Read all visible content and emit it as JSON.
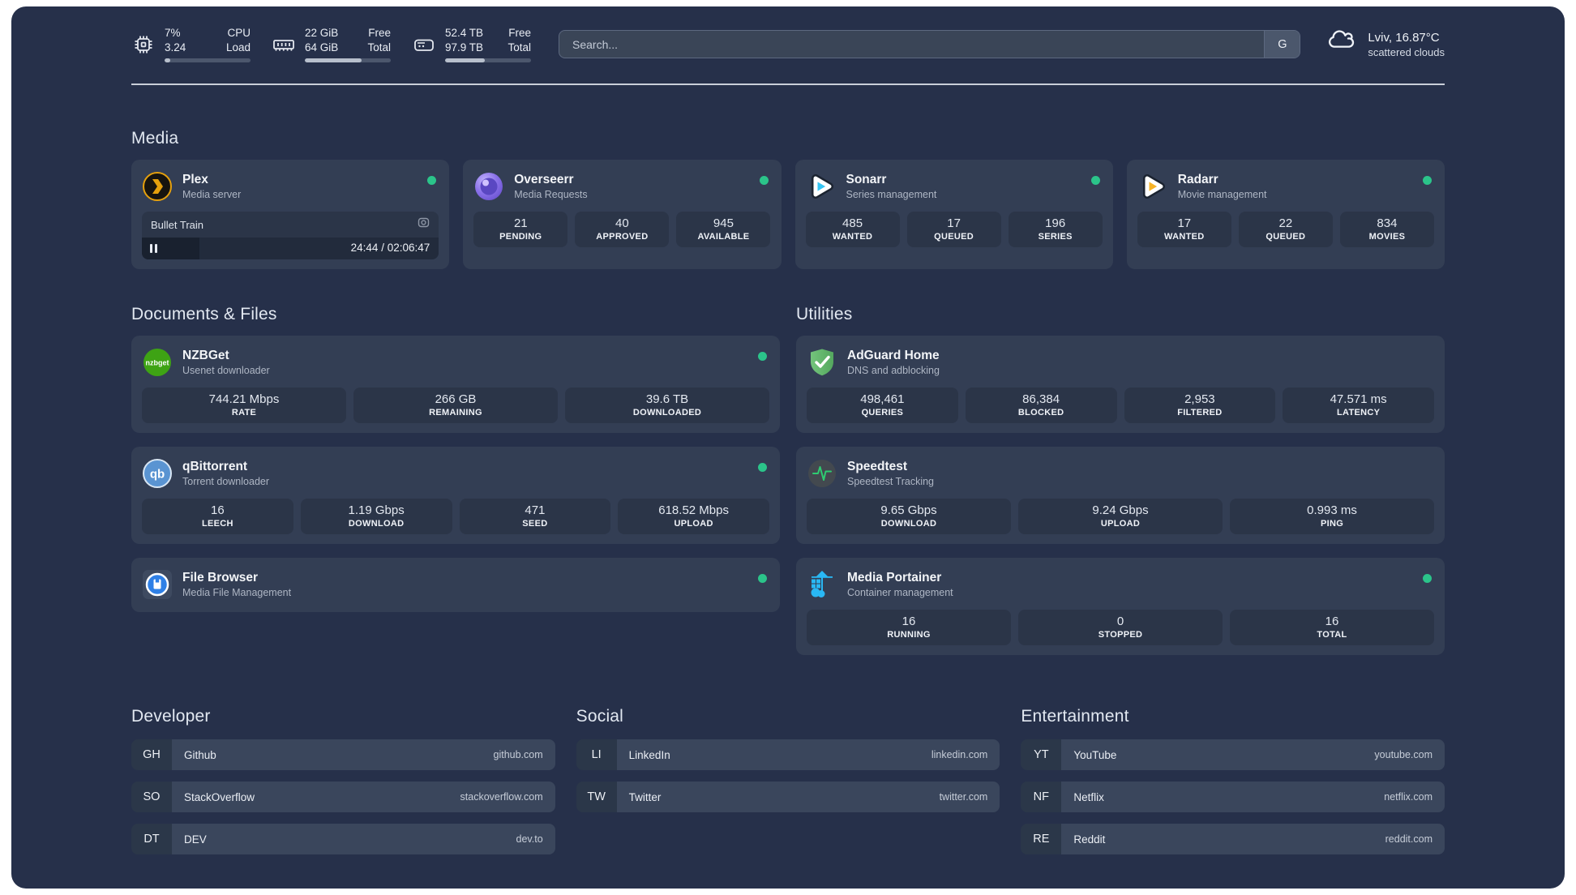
{
  "colors": {
    "status_online": "#2bc48a",
    "panel_bg": "#26304a",
    "card_bg": "#333e54",
    "stat_bg": "#2b3548"
  },
  "topbar": {
    "resources": [
      {
        "icon": "cpu-icon",
        "values": [
          "7%",
          "3.24"
        ],
        "labels": [
          "CPU",
          "Load"
        ],
        "percent": 7
      },
      {
        "icon": "memory-icon",
        "values": [
          "22 GiB",
          "64 GiB"
        ],
        "labels": [
          "Free",
          "Total"
        ],
        "percent": 66
      },
      {
        "icon": "disk-icon",
        "values": [
          "52.4 TB",
          "97.9 TB"
        ],
        "labels": [
          "Free",
          "Total"
        ],
        "percent": 46
      }
    ],
    "search": {
      "placeholder": "Search...",
      "provider_button": "G"
    },
    "weather": {
      "title": "Lviv, 16.87°C",
      "subtitle": "scattered clouds"
    }
  },
  "media": {
    "title": "Media",
    "cards": [
      {
        "title": "Plex",
        "subtitle": "Media server",
        "online": true,
        "player": {
          "track": "Bullet Train",
          "time": "24:44 / 02:06:47",
          "progress_percent": 19.5
        }
      },
      {
        "title": "Overseerr",
        "subtitle": "Media Requests",
        "online": true,
        "stats": [
          {
            "value": "21",
            "label": "PENDING"
          },
          {
            "value": "40",
            "label": "APPROVED"
          },
          {
            "value": "945",
            "label": "AVAILABLE"
          }
        ]
      },
      {
        "title": "Sonarr",
        "subtitle": "Series management",
        "online": true,
        "stats": [
          {
            "value": "485",
            "label": "WANTED"
          },
          {
            "value": "17",
            "label": "QUEUED"
          },
          {
            "value": "196",
            "label": "SERIES"
          }
        ]
      },
      {
        "title": "Radarr",
        "subtitle": "Movie management",
        "online": true,
        "stats": [
          {
            "value": "17",
            "label": "WANTED"
          },
          {
            "value": "22",
            "label": "QUEUED"
          },
          {
            "value": "834",
            "label": "MOVIES"
          }
        ]
      }
    ]
  },
  "docs": {
    "title": "Documents & Files",
    "cards": [
      {
        "title": "NZBGet",
        "subtitle": "Usenet downloader",
        "online": true,
        "stats": [
          {
            "value": "744.21 Mbps",
            "label": "RATE"
          },
          {
            "value": "266 GB",
            "label": "REMAINING"
          },
          {
            "value": "39.6 TB",
            "label": "DOWNLOADED"
          }
        ]
      },
      {
        "title": "qBittorrent",
        "subtitle": "Torrent downloader",
        "online": true,
        "stats": [
          {
            "value": "16",
            "label": "LEECH"
          },
          {
            "value": "1.19 Gbps",
            "label": "DOWNLOAD"
          },
          {
            "value": "471",
            "label": "SEED"
          },
          {
            "value": "618.52 Mbps",
            "label": "UPLOAD"
          }
        ]
      },
      {
        "title": "File Browser",
        "subtitle": "Media File Management",
        "online": true,
        "stats": []
      }
    ]
  },
  "utilities": {
    "title": "Utilities",
    "cards": [
      {
        "title": "AdGuard Home",
        "subtitle": "DNS and adblocking",
        "online": false,
        "stats": [
          {
            "value": "498,461",
            "label": "QUERIES"
          },
          {
            "value": "86,384",
            "label": "BLOCKED"
          },
          {
            "value": "2,953",
            "label": "FILTERED"
          },
          {
            "value": "47.571 ms",
            "label": "LATENCY"
          }
        ]
      },
      {
        "title": "Speedtest",
        "subtitle": "Speedtest Tracking",
        "online": false,
        "stats": [
          {
            "value": "9.65 Gbps",
            "label": "DOWNLOAD"
          },
          {
            "value": "9.24 Gbps",
            "label": "UPLOAD"
          },
          {
            "value": "0.993 ms",
            "label": "PING"
          }
        ]
      },
      {
        "title": "Media Portainer",
        "subtitle": "Container management",
        "online": true,
        "stats": [
          {
            "value": "16",
            "label": "RUNNING"
          },
          {
            "value": "0",
            "label": "STOPPED"
          },
          {
            "value": "16",
            "label": "TOTAL"
          }
        ]
      }
    ]
  },
  "bookmarks": [
    {
      "title": "Developer",
      "items": [
        {
          "abbr": "GH",
          "name": "Github",
          "url": "github.com"
        },
        {
          "abbr": "SO",
          "name": "StackOverflow",
          "url": "stackoverflow.com"
        },
        {
          "abbr": "DT",
          "name": "DEV",
          "url": "dev.to"
        }
      ]
    },
    {
      "title": "Social",
      "items": [
        {
          "abbr": "LI",
          "name": "LinkedIn",
          "url": "linkedin.com"
        },
        {
          "abbr": "TW",
          "name": "Twitter",
          "url": "twitter.com"
        }
      ]
    },
    {
      "title": "Entertainment",
      "items": [
        {
          "abbr": "YT",
          "name": "YouTube",
          "url": "youtube.com"
        },
        {
          "abbr": "NF",
          "name": "Netflix",
          "url": "netflix.com"
        },
        {
          "abbr": "RE",
          "name": "Reddit",
          "url": "reddit.com"
        }
      ]
    }
  ]
}
